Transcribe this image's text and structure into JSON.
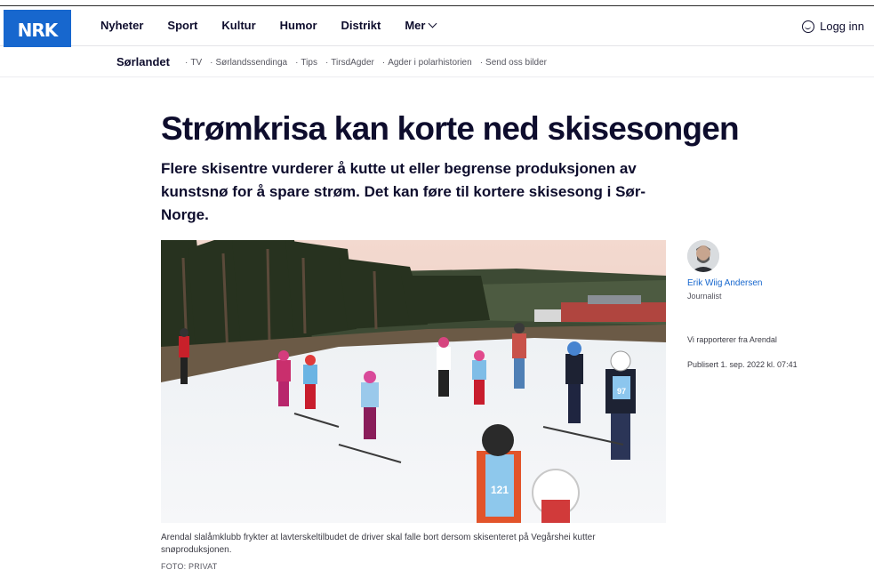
{
  "header": {
    "logo": "NRK",
    "nav": [
      {
        "label": "Nyheter"
      },
      {
        "label": "Sport"
      },
      {
        "label": "Kultur"
      },
      {
        "label": "Humor"
      },
      {
        "label": "Distrikt"
      },
      {
        "label": "Mer"
      }
    ],
    "login_label": "Logg inn"
  },
  "subnav": {
    "region": "Sørlandet",
    "links": [
      "TV",
      "Sørlandssendinga",
      "Tips",
      "TirsdAgder",
      "Agder i polarhistorien",
      "Send oss bilder"
    ]
  },
  "article": {
    "headline": "Strømkrisa kan korte ned skisesongen",
    "lead": "Flere skisentre vurderer å kutte ut eller begrense produksjonen av kunstsnø for å spare strøm. Det kan føre til kortere skisesong i Sør-Norge.",
    "image_caption": "Arendal slalåmklubb frykter at lavterskeltilbudet de driver skal falle bort dersom skisenteret på Vegårshei kutter snøproduksjonen.",
    "image_credit": "FOTO: PRIVAT",
    "bib_numbers": [
      "97",
      "121"
    ]
  },
  "byline": {
    "author": "Erik Wiig Andersen",
    "role": "Journalist",
    "reporting_from": "Vi rapporterer fra Arendal",
    "published": "Publisert 1. sep. 2022 kl. 07:41"
  },
  "colors": {
    "brand": "#1767ce",
    "text": "#0e0d2d"
  }
}
